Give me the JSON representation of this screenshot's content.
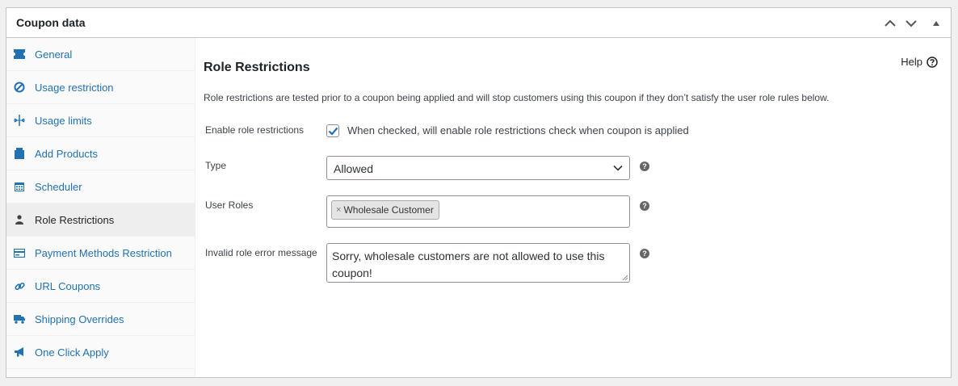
{
  "panel": {
    "title": "Coupon data"
  },
  "sidebar": {
    "items": [
      {
        "label": "General",
        "icon": "ticket-icon"
      },
      {
        "label": "Usage restriction",
        "icon": "ban-icon"
      },
      {
        "label": "Usage limits",
        "icon": "limits-icon"
      },
      {
        "label": "Add Products",
        "icon": "box-icon"
      },
      {
        "label": "Scheduler",
        "icon": "calendar-icon"
      },
      {
        "label": "Role Restrictions",
        "icon": "user-icon",
        "active": true
      },
      {
        "label": "Payment Methods Restriction",
        "icon": "card-icon"
      },
      {
        "label": "URL Coupons",
        "icon": "link-icon"
      },
      {
        "label": "Shipping Overrides",
        "icon": "truck-icon"
      },
      {
        "label": "One Click Apply",
        "icon": "megaphone-icon"
      }
    ]
  },
  "main": {
    "heading": "Role Restrictions",
    "help_label": "Help",
    "description": "Role restrictions are tested prior to a coupon being applied and will stop customers using this coupon if they don’t satisfy the user role rules below.",
    "enable": {
      "label": "Enable role restrictions",
      "checked": true,
      "text": "When checked, will enable role restrictions check when coupon is applied"
    },
    "type": {
      "label": "Type",
      "value": "Allowed",
      "tooltip": "?"
    },
    "roles": {
      "label": "User Roles",
      "tags": [
        "Wholesale Customer"
      ],
      "remove_glyph": "×",
      "tooltip": "?"
    },
    "error_message": {
      "label": "Invalid role error message",
      "value": "Sorry, wholesale customers are not allowed to use this coupon!",
      "tooltip": "?"
    }
  },
  "colors": {
    "link": "#2271b1",
    "text": "#1d2327",
    "border": "#c3c4c7",
    "active_tab_bg": "#eeeeee"
  }
}
